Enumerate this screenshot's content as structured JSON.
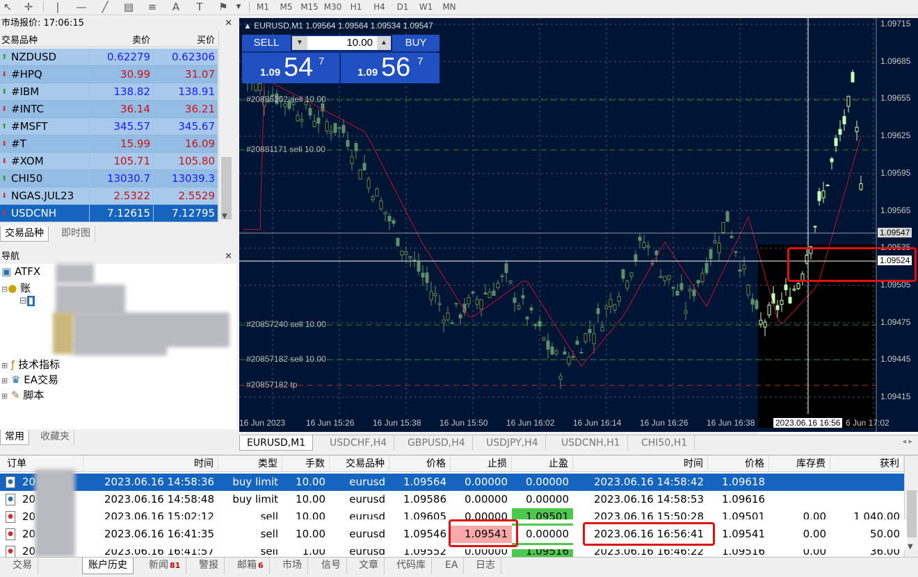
{
  "toolbar": {
    "timeframes": [
      "M1",
      "M5",
      "M15",
      "M30",
      "H1",
      "H4",
      "D1",
      "W1",
      "MN"
    ]
  },
  "market_watch": {
    "title": "市场报价: 17:06:15",
    "headers": [
      "交易品种",
      "卖价",
      "买价"
    ],
    "rows": [
      {
        "symbol": "NZDUSD",
        "bid": "0.62279",
        "ask": "0.62306",
        "dir": "up",
        "color": "#1a1aff"
      },
      {
        "symbol": "#HPQ",
        "bid": "30.99",
        "ask": "31.07",
        "dir": "down",
        "color": "#d01010"
      },
      {
        "symbol": "#IBM",
        "bid": "138.82",
        "ask": "138.91",
        "dir": "up",
        "color": "#1a1aff"
      },
      {
        "symbol": "#INTC",
        "bid": "36.14",
        "ask": "36.21",
        "dir": "down",
        "color": "#d01010"
      },
      {
        "symbol": "#MSFT",
        "bid": "345.57",
        "ask": "345.67",
        "dir": "up",
        "color": "#1a1aff"
      },
      {
        "symbol": "#T",
        "bid": "15.99",
        "ask": "16.09",
        "dir": "down",
        "color": "#d01010"
      },
      {
        "symbol": "#XOM",
        "bid": "105.71",
        "ask": "105.80",
        "dir": "down",
        "color": "#d01010"
      },
      {
        "symbol": "CHI50",
        "bid": "13030.7",
        "ask": "13039.3",
        "dir": "up",
        "color": "#1a1aff"
      },
      {
        "symbol": "NGAS.JUL23",
        "bid": "2.5322",
        "ask": "2.5529",
        "dir": "down",
        "color": "#d01010"
      },
      {
        "symbol": "USDCNH",
        "bid": "7.12615",
        "ask": "7.12795",
        "dir": "down",
        "color": "#ffffff"
      }
    ],
    "tabs": [
      "交易品种",
      "即时图"
    ]
  },
  "navigator": {
    "title": "导航",
    "broker": "ATFX",
    "accounts": "账",
    "items": [
      "技术指标",
      "EA交易",
      "脚本"
    ],
    "tabs": [
      "常用",
      "收藏夹"
    ]
  },
  "chart": {
    "title": "EURUSD,M1  1.09564 1.09564 1.09534 1.09547",
    "sell_label": "SELL",
    "buy_label": "BUY",
    "lot": "10.00",
    "sell_prefix": "1.09",
    "sell_big": "54",
    "sell_sup": "7",
    "buy_prefix": "1.09",
    "buy_big": "56",
    "buy_sup": "7",
    "price_labels": [
      "1.09715",
      "1.09685",
      "1.09655",
      "1.09625",
      "1.09595",
      "1.09565",
      "1.09535",
      "1.09505",
      "1.09475",
      "1.09445",
      "1.09415"
    ],
    "current_price": "1.09547",
    "cross_price": "1.09524",
    "order_lines": [
      "#20885252 sell 10.00",
      "#20881171 sell 10.00",
      "#20857240 sell 10.00",
      "#20857182 sell 10.00",
      "#20857182 tp"
    ],
    "time_labels": [
      "16 Jun 2023",
      "16 Jun 15:26",
      "16 Jun 15:38",
      "16 Jun 15:50",
      "16 Jun 16:02",
      "16 Jun 16:14",
      "16 Jun 16:26",
      "16 Jun 16:38",
      "2023.06.16 16:56",
      "6 Jun 17:02"
    ],
    "tabs": [
      "EURUSD,M1",
      "USDCHF,H4",
      "GBPUSD,H4",
      "USDJPY,H4",
      "USDCNH,H1",
      "CHI50,H1"
    ]
  },
  "terminal": {
    "headers": [
      "订单",
      "时间",
      "类型",
      "手数",
      "交易品种",
      "价格",
      "止损",
      "止盈",
      "时间",
      "价格",
      "库存费",
      "获利"
    ],
    "rows": [
      {
        "order": "20",
        "open_time": "2023.06.16 14:58:36",
        "type": "buy limit",
        "lots": "10.00",
        "symbol": "eurusd",
        "price": "1.09564",
        "sl": "0.00000",
        "tp": "0.00000",
        "close_time": "2023.06.16 14:58:42",
        "close_price": "1.09618",
        "swap": "",
        "profit": ""
      },
      {
        "order": "20",
        "open_time": "2023.06.16 14:58:48",
        "type": "buy limit",
        "lots": "10.00",
        "symbol": "eurusd",
        "price": "1.09586",
        "sl": "0.00000",
        "tp": "0.00000",
        "close_time": "2023.06.16 14:58:53",
        "close_price": "1.09616",
        "swap": "",
        "profit": ""
      },
      {
        "order": "20",
        "open_time": "2023.06.16 15:02:12",
        "type": "sell",
        "lots": "10.00",
        "symbol": "eurusd",
        "price": "1.09605",
        "sl": "0.00000",
        "tp": "1.09501",
        "close_time": "2023.06.16 15:50:28",
        "close_price": "1.09501",
        "swap": "0.00",
        "profit": "1 040.00"
      },
      {
        "order": "20",
        "open_time": "2023.06.16 16:41:35",
        "type": "sell",
        "lots": "10.00",
        "symbol": "eurusd",
        "price": "1.09546",
        "sl": "1.09541",
        "tp": "0.00000",
        "close_time": "2023.06.16 16:56:41",
        "close_price": "1.09541",
        "swap": "0.00",
        "profit": "50.00"
      },
      {
        "order": "20",
        "open_time": "2023.06.16 16:41:57",
        "type": "sell",
        "lots": "1.00",
        "symbol": "eurusd",
        "price": "1.09552",
        "sl": "0.00000",
        "tp": "1.09516",
        "close_time": "2023.06.16 16:46:22",
        "close_price": "1.09516",
        "swap": "0.00",
        "profit": "36.00"
      }
    ],
    "tabs": [
      {
        "label": "交易"
      },
      {
        "label": "账户历史"
      },
      {
        "label": "新闻",
        "badge": "81"
      },
      {
        "label": "警报"
      },
      {
        "label": "邮箱",
        "badge": "6"
      },
      {
        "label": "市场"
      },
      {
        "label": "信号"
      },
      {
        "label": "文章"
      },
      {
        "label": "代码库"
      },
      {
        "label": "EA"
      },
      {
        "label": "日志"
      }
    ]
  }
}
